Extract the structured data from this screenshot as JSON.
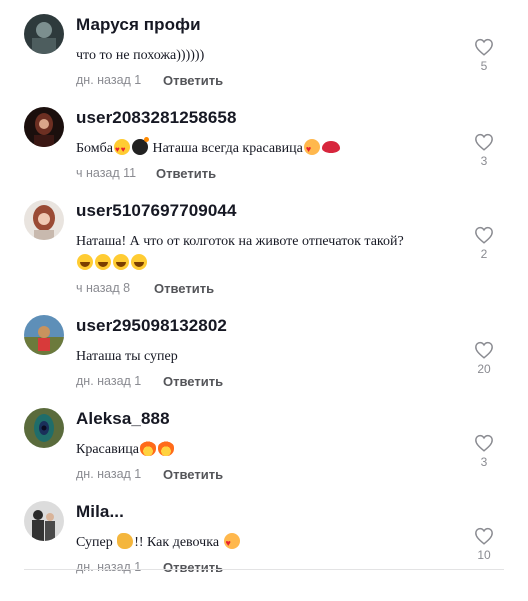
{
  "comments": [
    {
      "username": "Маруся профи",
      "text": "что то не похожа))))))",
      "time": "дн. назад 1",
      "reply": "Ответить",
      "likes": "5"
    },
    {
      "username": "user2083281258658",
      "text_parts": [
        "Бомба",
        " ",
        "Наташа всегда красавица"
      ],
      "time": "ч назад 11",
      "reply": "Ответить",
      "likes": "3"
    },
    {
      "username": "user5107697709044",
      "text": "Наташа! А что от колготок на животе отпечаток такой?",
      "time": "ч назад 8",
      "reply": "Ответить",
      "likes": "2"
    },
    {
      "username": "user295098132802",
      "text": "Наташа ты супер",
      "time": "дн. назад 1",
      "reply": "Ответить",
      "likes": "20"
    },
    {
      "username": "Aleksa_888",
      "text": "Красавица",
      "time": "дн. назад 1",
      "reply": "Ответить",
      "likes": "3"
    },
    {
      "username": "Mila...",
      "text_parts": [
        "Супер ",
        "!! Как девочка "
      ],
      "time": "дн. назад 1",
      "reply": "Ответить",
      "likes": "10"
    }
  ],
  "icons": {
    "like": "heart-outline-icon"
  },
  "colors": {
    "username": "#161823",
    "meta": "#8a8b91",
    "reply": "#545559"
  }
}
